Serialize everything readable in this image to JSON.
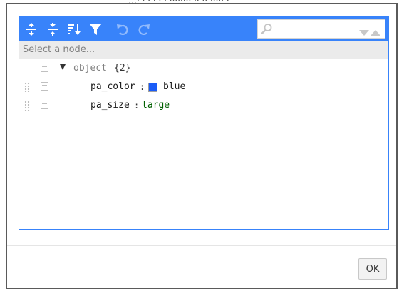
{
  "background_text": "…· · · · · · ········ ·· ·· ····· ·",
  "toolbar": {
    "buttons": [
      {
        "name": "expand-all-icon"
      },
      {
        "name": "collapse-all-icon"
      },
      {
        "name": "sort-icon"
      },
      {
        "name": "filter-icon"
      },
      {
        "name": "undo-icon",
        "disabled": true
      },
      {
        "name": "redo-icon",
        "disabled": true
      }
    ],
    "accent_color": "#3883fa"
  },
  "search": {
    "value": "",
    "placeholder": ""
  },
  "navigation": {
    "placeholder": "Select a node..."
  },
  "tree": {
    "root": {
      "field": "object",
      "count": "{2}",
      "expanded": true
    },
    "children": [
      {
        "key": "pa_color",
        "separator": ":",
        "value": "blue",
        "swatch_color": "#1a5cf7",
        "value_color": "#1a1a1a"
      },
      {
        "key": "pa_size",
        "separator": ":",
        "value": "large",
        "value_color": "#006000"
      }
    ]
  },
  "footer": {
    "ok_label": "OK"
  }
}
